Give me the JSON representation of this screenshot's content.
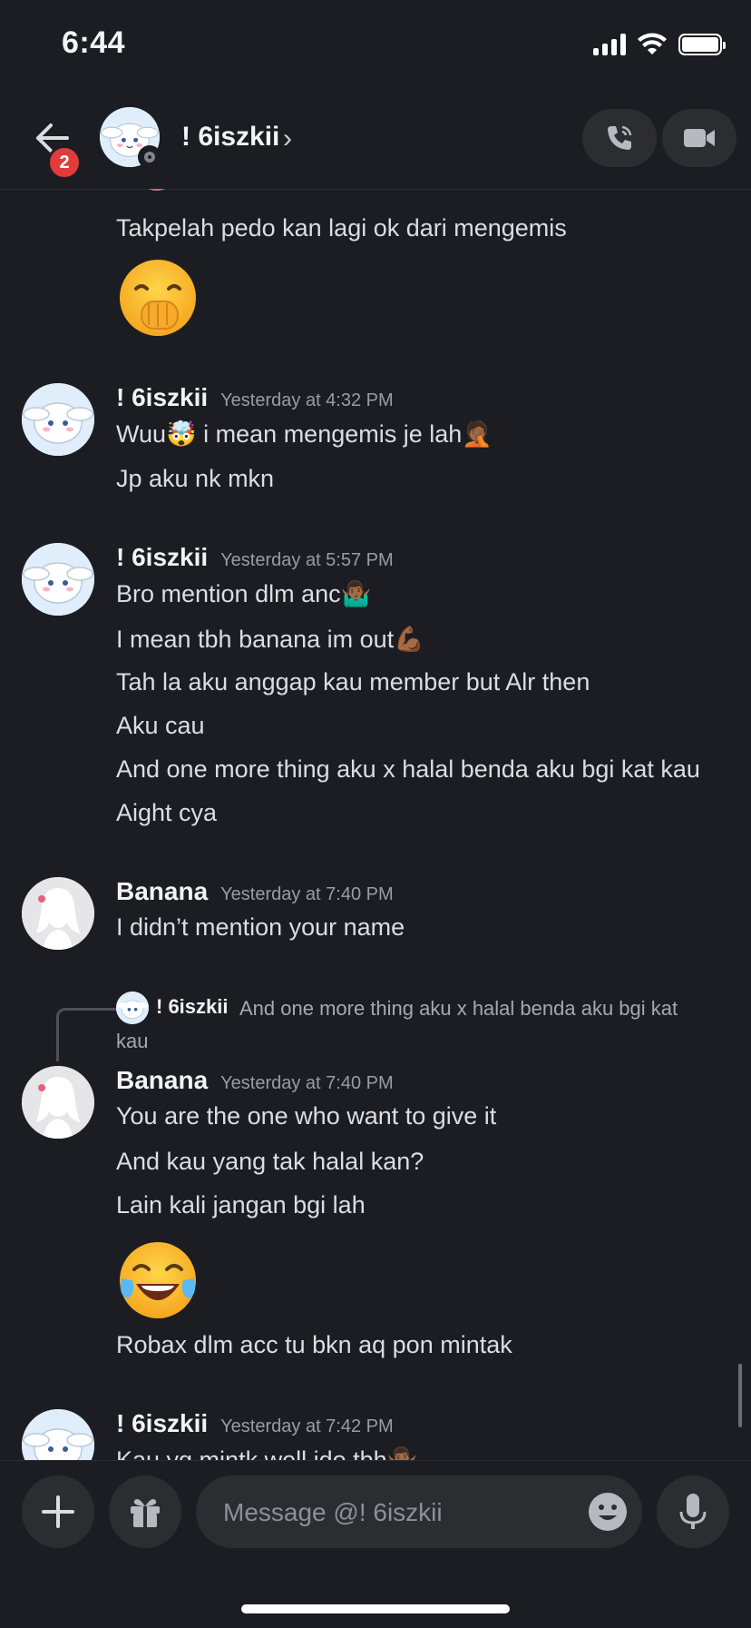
{
  "status_bar": {
    "time": "6:44"
  },
  "header": {
    "back_badge": "2",
    "name": "! 6iszkii",
    "chevron": "›",
    "call_icon": "phone-icon",
    "video_icon": "video-camera-icon"
  },
  "messages": {
    "m0": {
      "text": "Takpelah pedo kan lagi ok dari mengemis",
      "emoji": "hand-over-mouth-emoji"
    },
    "m1": {
      "author": "! 6iszkii",
      "time": "Yesterday at 4:32 PM",
      "lines": [
        "Wuu🤯 i mean mengemis je lah🤦🏾",
        "Jp aku nk mkn"
      ]
    },
    "m2": {
      "author": "! 6iszkii",
      "time": "Yesterday at 5:57 PM",
      "lines": [
        "Bro mention dlm anc🤷🏾‍♂️",
        "I mean tbh banana im out💪🏾",
        "Tah la aku anggap kau member but Alr then",
        "Aku cau",
        "And one more thing aku x halal benda aku bgi kat kau",
        "Aight cya"
      ]
    },
    "m3": {
      "author": "Banana",
      "time": "Yesterday at 7:40 PM",
      "lines": [
        "I didn’t mention your name"
      ]
    },
    "reply": {
      "author": "! 6iszkii",
      "text_1": "And one more thing aku x halal benda aku bgi kat",
      "text_2": "kau"
    },
    "m4": {
      "author": "Banana",
      "time": "Yesterday at 7:40 PM",
      "lines": [
        "You are the one who want to give it",
        "And kau yang tak halal kan?",
        "Lain kali jangan bgi lah"
      ],
      "emoji": "face-with-tears-of-joy-emoji",
      "after": "Robax dlm acc tu bkn aq pon mintak"
    },
    "m5": {
      "author": "! 6iszkii",
      "time": "Yesterday at 7:42 PM",
      "lines": [
        "Kau yg mintk well ido tbh🤷🏾‍♂️"
      ]
    }
  },
  "composer": {
    "placeholder": "Message @! 6iszkii",
    "plus_icon": "plus-icon",
    "gift_icon": "gift-icon",
    "emoji_icon": "emoji-picker-icon",
    "mic_icon": "microphone-icon"
  }
}
